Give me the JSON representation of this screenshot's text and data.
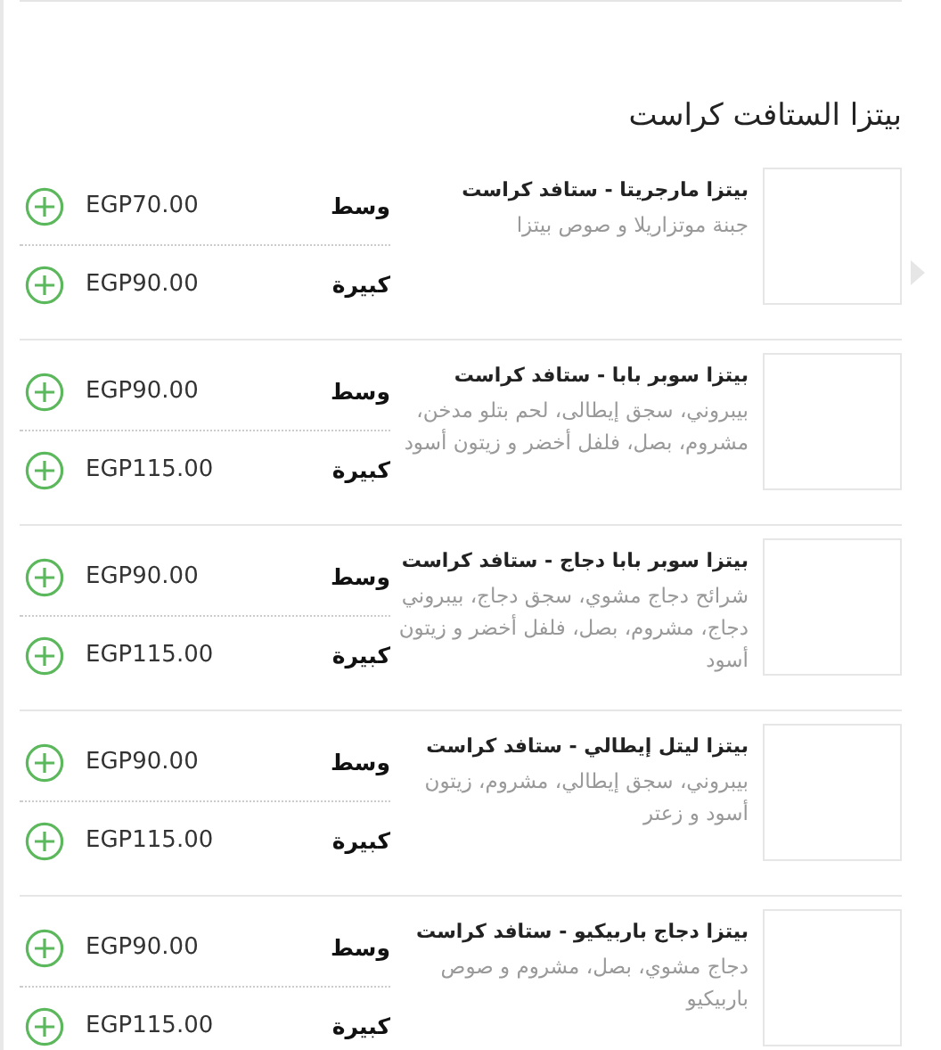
{
  "section": {
    "title": "بيتزا الستافت كراست"
  },
  "items": [
    {
      "name": "بيتزا مارجريتا - ستافد كراست",
      "description": "جبنة موتزاريلا و صوص بيتزا",
      "selected": true,
      "sizes": [
        {
          "label": "وسط",
          "price": "EGP70.00"
        },
        {
          "label": "كبيرة",
          "price": "EGP90.00"
        }
      ]
    },
    {
      "name": "بيتزا سوبر بابا - ستافد كراست",
      "selected": false,
      "description": "بيبروني، سجق إيطالى، لحم بتلو مدخن، مشروم، بصل، فلفل أخضر و زيتون أسود",
      "sizes": [
        {
          "label": "وسط",
          "price": "EGP90.00"
        },
        {
          "label": "كبيرة",
          "price": "EGP115.00"
        }
      ]
    },
    {
      "name": "بيتزا سوبر بابا دجاج - ستافد كراست",
      "selected": false,
      "description": "شرائح دجاج مشوي، سجق دجاج، بيبروني دجاج، مشروم، بصل، فلفل أخضر و زيتون أسود",
      "sizes": [
        {
          "label": "وسط",
          "price": "EGP90.00"
        },
        {
          "label": "كبيرة",
          "price": "EGP115.00"
        }
      ]
    },
    {
      "name": "بيتزا ليتل إيطالي - ستافد كراست",
      "selected": false,
      "description": "بيبروني، سجق إيطالي، مشروم، زيتون أسود و زعتر",
      "sizes": [
        {
          "label": "وسط",
          "price": "EGP90.00"
        },
        {
          "label": "كبيرة",
          "price": "EGP115.00"
        }
      ]
    },
    {
      "name": "بيتزا دجاج باربيكيو - ستافد كراست",
      "selected": false,
      "description": "دجاج مشوي، بصل، مشروم و صوص باربيكيو",
      "sizes": [
        {
          "label": "وسط",
          "price": "EGP90.00"
        },
        {
          "label": "كبيرة",
          "price": "EGP115.00"
        }
      ]
    }
  ]
}
